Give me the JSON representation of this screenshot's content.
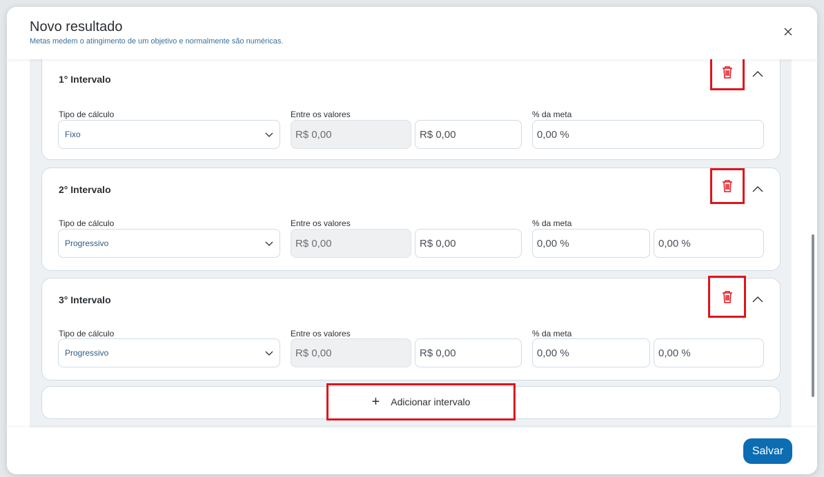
{
  "modal": {
    "title": "Novo resultado",
    "subtitle": "Metas medem o atingimento de um objetivo e normalmente são numéricas.",
    "close_icon": "close-icon"
  },
  "labels": {
    "calc_type": "Tipo de cálculo",
    "between_values": "Entre os valores",
    "goal_percent": "% da meta"
  },
  "intervals": [
    {
      "title": "1° Intervalo",
      "calc_type": "Fixo",
      "value_from": "R$ 0,00",
      "value_to": "R$ 0,00",
      "percent_1": "0,00 %"
    },
    {
      "title": "2° Intervalo",
      "calc_type": "Progressivo",
      "value_from": "R$ 0,00",
      "value_to": "R$ 0,00",
      "percent_1": "0,00 %",
      "percent_2": "0,00 %"
    },
    {
      "title": "3° Intervalo",
      "calc_type": "Progressivo",
      "value_from": "R$ 0,00",
      "value_to": "R$ 0,00",
      "percent_1": "0,00 %",
      "percent_2": "0,00 %"
    }
  ],
  "add_interval": {
    "plus": "+",
    "label": "Adicionar intervalo"
  },
  "footer": {
    "save_label": "Salvar"
  },
  "colors": {
    "accent": "#0d6db3",
    "highlight": "#e0141b",
    "trash": "#e0141b"
  }
}
